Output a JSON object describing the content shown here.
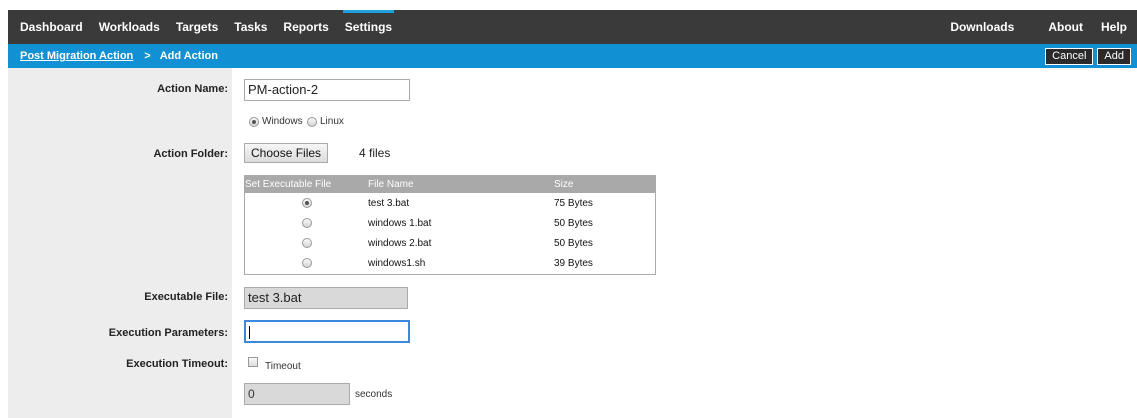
{
  "nav": {
    "tabs": [
      "Dashboard",
      "Workloads",
      "Targets",
      "Tasks",
      "Reports",
      "Settings"
    ],
    "active": "Settings",
    "right": [
      "Downloads",
      "About",
      "Help"
    ]
  },
  "breadcrumb": {
    "parent": "Post Migration Action",
    "separator": ">",
    "current": "Add Action"
  },
  "toolbar": {
    "cancel_label": "Cancel",
    "add_label": "Add"
  },
  "form": {
    "action_name_label": "Action Name:",
    "action_name_value": "PM-action-2",
    "os_windows": "Windows",
    "os_linux": "Linux",
    "os_selected": "Windows",
    "action_folder_label": "Action Folder:",
    "choose_files_label": "Choose Files",
    "files_count_text": "4 files",
    "executable_file_label": "Executable File:",
    "executable_file_value": "test 3.bat",
    "execution_parameters_label": "Execution Parameters:",
    "execution_parameters_value": "",
    "execution_timeout_label": "Execution Timeout:",
    "timeout_checkbox_label": "Timeout",
    "timeout_checked": false,
    "timeout_value": "0",
    "timeout_unit": "seconds"
  },
  "files_table": {
    "headers": [
      "Set Executable File",
      "File Name",
      "Size"
    ],
    "rows": [
      {
        "selected": true,
        "name": "test 3.bat",
        "size": "75 Bytes"
      },
      {
        "selected": false,
        "name": "windows 1.bat",
        "size": "50 Bytes"
      },
      {
        "selected": false,
        "name": "windows 2.bat",
        "size": "50 Bytes"
      },
      {
        "selected": false,
        "name": "windows1.sh",
        "size": "39 Bytes"
      }
    ]
  }
}
